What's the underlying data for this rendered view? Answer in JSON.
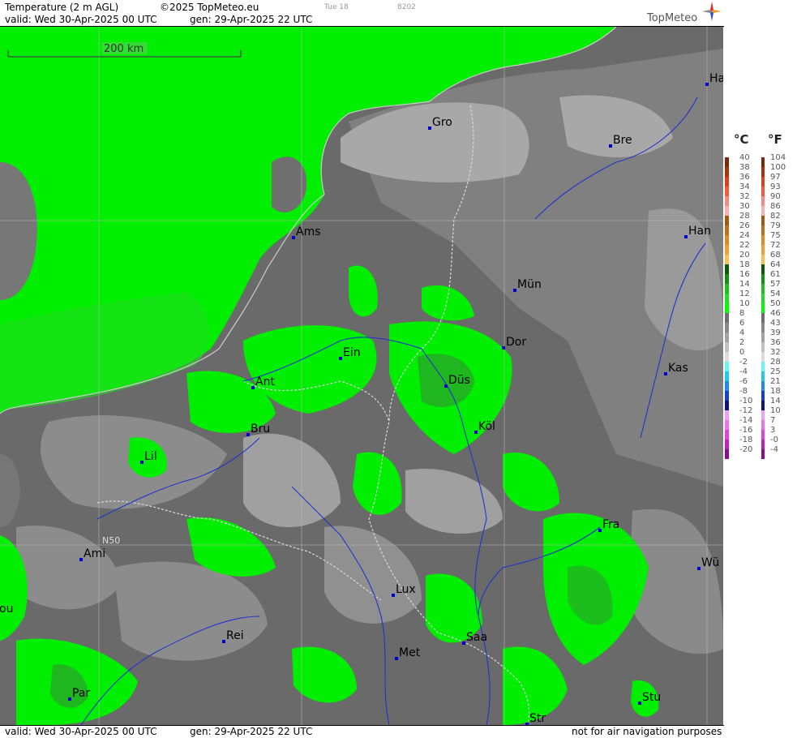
{
  "header": {
    "title": "Temperature (2 m AGL)",
    "copyright": "©2025 TopMeteo.eu",
    "small_a": "Tue 18",
    "small_b": "8202",
    "valid": "valid:  Wed  30-Apr-2025  00 UTC",
    "gen": "gen: 29-Apr-2025 22 UTC",
    "logo": "TopMeteo"
  },
  "footer": {
    "valid": "valid:  Wed  30-Apr-2025  00 UTC",
    "gen": "gen: 29-Apr-2025 22 UTC",
    "note": "not for air navigation purposes"
  },
  "map": {
    "scale_label": "200 km",
    "lat_label": "N50",
    "colors": {
      "sea_green": "#00ee00",
      "dark_green": "#2e9e2e",
      "grey_dark": "#5f5f5f",
      "grey_mid": "#828282",
      "grey_light": "#a6a6a6",
      "river": "#2233cc",
      "border": "#cccccc"
    },
    "cities": [
      {
        "name": "Ha"
      },
      {
        "name": "Gro"
      },
      {
        "name": "Bre"
      },
      {
        "name": "Han"
      },
      {
        "name": "Ams"
      },
      {
        "name": "Mün"
      },
      {
        "name": "Ein"
      },
      {
        "name": "Dor"
      },
      {
        "name": "Kas"
      },
      {
        "name": "Ant"
      },
      {
        "name": "Düs"
      },
      {
        "name": "Köl"
      },
      {
        "name": "Bru"
      },
      {
        "name": "Lil"
      },
      {
        "name": "Fra"
      },
      {
        "name": "Ami"
      },
      {
        "name": "Wü"
      },
      {
        "name": "Lux"
      },
      {
        "name": "ou"
      },
      {
        "name": "Rei"
      },
      {
        "name": "Saa"
      },
      {
        "name": "Met"
      },
      {
        "name": "Par"
      },
      {
        "name": "Stu"
      },
      {
        "name": "Str"
      }
    ]
  },
  "legend": {
    "unit_c": "°C",
    "unit_f": "°F",
    "celsius": [
      "40",
      "38",
      "36",
      "34",
      "32",
      "30",
      "28",
      "26",
      "24",
      "22",
      "20",
      "18",
      "16",
      "14",
      "12",
      "10",
      "8",
      "6",
      "4",
      "2",
      "0",
      "-2",
      "-4",
      "-6",
      "-8",
      "-10",
      "-12",
      "-14",
      "-16",
      "-18",
      "-20"
    ],
    "fahrenheit": [
      "104",
      "100",
      "97",
      "93",
      "90",
      "86",
      "82",
      "79",
      "75",
      "72",
      "68",
      "64",
      "61",
      "57",
      "54",
      "50",
      "46",
      "43",
      "39",
      "36",
      "32",
      "28",
      "25",
      "21",
      "18",
      "14",
      "10",
      "7",
      "3",
      "-0",
      "-4"
    ],
    "colors": [
      "#7a2a0a",
      "#a8320a",
      "#d8421a",
      "#f25a3a",
      "#f78a80",
      "#f6b0b0",
      "#a05a10",
      "#c07018",
      "#e08a20",
      "#f0a030",
      "#f8c050",
      "#0a5a0a",
      "#139013",
      "#1fbf1f",
      "#22dd22",
      "#00ff00",
      "#6e6e6e",
      "#888888",
      "#a2a2a2",
      "#c0c0c0",
      "#dcdcdc",
      "#66f6f6",
      "#22c8f0",
      "#2288ee",
      "#1840cc",
      "#101080",
      "#f0a0f0",
      "#f070f0",
      "#e040e0",
      "#c020c0",
      "#8a108a"
    ]
  }
}
